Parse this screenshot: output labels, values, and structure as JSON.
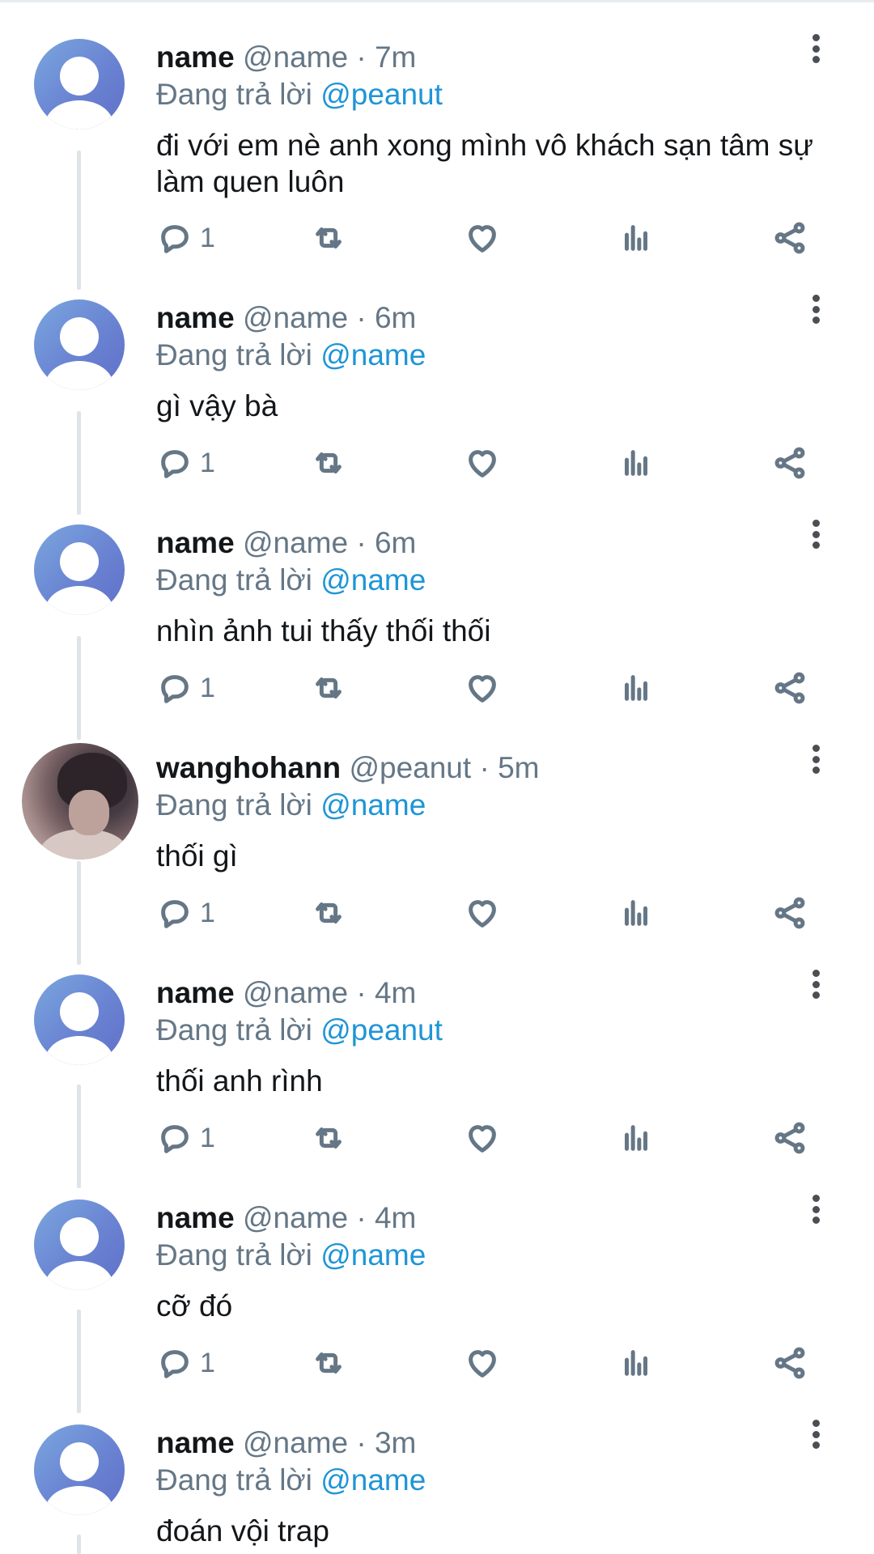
{
  "colors": {
    "accent": "#1f95d6",
    "muted": "#657786",
    "text": "#14171a"
  },
  "icons": {
    "reply": "reply-icon",
    "retweet": "retweet-icon",
    "like": "heart-icon",
    "stats": "stats-icon",
    "share": "share-icon",
    "more": "more-vertical-icon"
  },
  "reply_prefix": "Đang trả lời",
  "tweets": [
    {
      "name": "name",
      "handle": "@name",
      "sep": "·",
      "time": "7m",
      "reply_to": "@peanut",
      "text": "đi với em nè anh xong mình vô khách sạn tâm sự làm quen luôn",
      "reply_count": "1",
      "avatar": "default-avatar"
    },
    {
      "name": "name",
      "handle": "@name",
      "sep": "·",
      "time": "6m",
      "reply_to": "@name",
      "text": "gì vậy bà",
      "reply_count": "1",
      "avatar": "default-avatar"
    },
    {
      "name": "name",
      "handle": "@name",
      "sep": "·",
      "time": "6m",
      "reply_to": "@name",
      "text": "nhìn ảnh tui thấy thối thối",
      "reply_count": "1",
      "avatar": "default-avatar"
    },
    {
      "name": "wanghohann",
      "handle": "@peanut",
      "sep": "·",
      "time": "5m",
      "reply_to": "@name",
      "text": "thối gì",
      "reply_count": "1",
      "avatar": "photo-avatar"
    },
    {
      "name": "name",
      "handle": "@name",
      "sep": "·",
      "time": "4m",
      "reply_to": "@peanut",
      "text": "thối anh rình",
      "reply_count": "1",
      "avatar": "default-avatar"
    },
    {
      "name": "name",
      "handle": "@name",
      "sep": "·",
      "time": "4m",
      "reply_to": "@name",
      "text": "cỡ đó",
      "reply_count": "1",
      "avatar": "default-avatar"
    },
    {
      "name": "name",
      "handle": "@name",
      "sep": "·",
      "time": "3m",
      "reply_to": "@name",
      "text": "đoán vội trap",
      "reply_count": "",
      "avatar": "default-avatar"
    }
  ]
}
